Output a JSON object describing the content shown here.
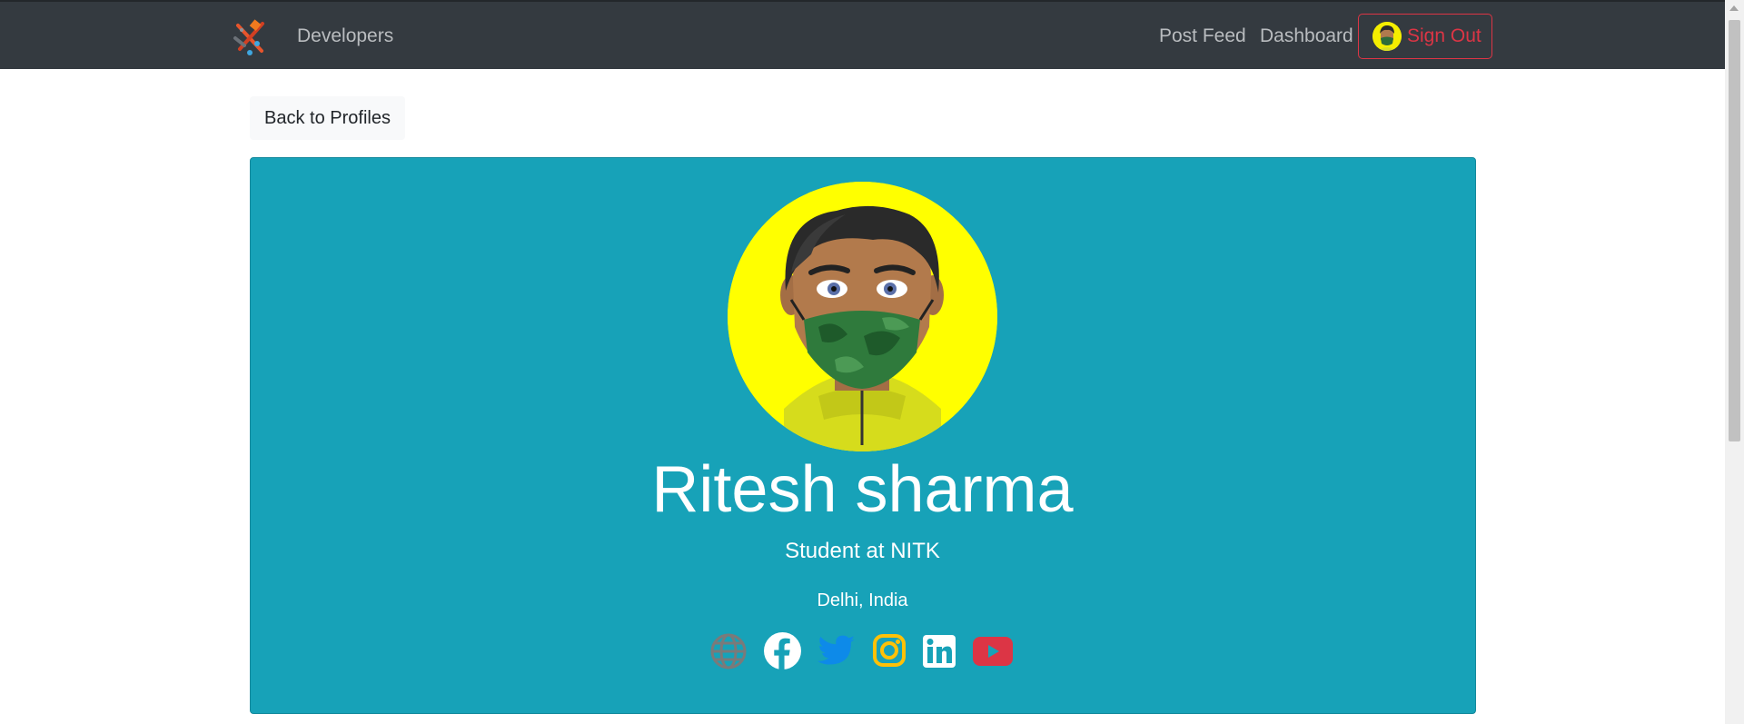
{
  "navbar": {
    "brand_label": "Developers",
    "links": [
      {
        "label": "Post Feed"
      },
      {
        "label": "Dashboard"
      }
    ],
    "signout_label": "Sign Out"
  },
  "back_button": {
    "label": "Back to Profiles"
  },
  "profile": {
    "name": "Ritesh sharma",
    "status": "Student at NITK",
    "location": "Delhi, India",
    "avatar_bg": "#ffff00",
    "card_bg": "#17a2b8",
    "social_links": [
      {
        "icon": "globe-icon",
        "color": "#777777"
      },
      {
        "icon": "facebook-icon",
        "color": "#ffffff"
      },
      {
        "icon": "twitter-icon",
        "color": "#0d8ae9"
      },
      {
        "icon": "instagram-icon",
        "color": "#ffc107"
      },
      {
        "icon": "linkedin-icon",
        "color": "#ffffff"
      },
      {
        "icon": "youtube-icon",
        "color": "#dc3545"
      }
    ]
  }
}
